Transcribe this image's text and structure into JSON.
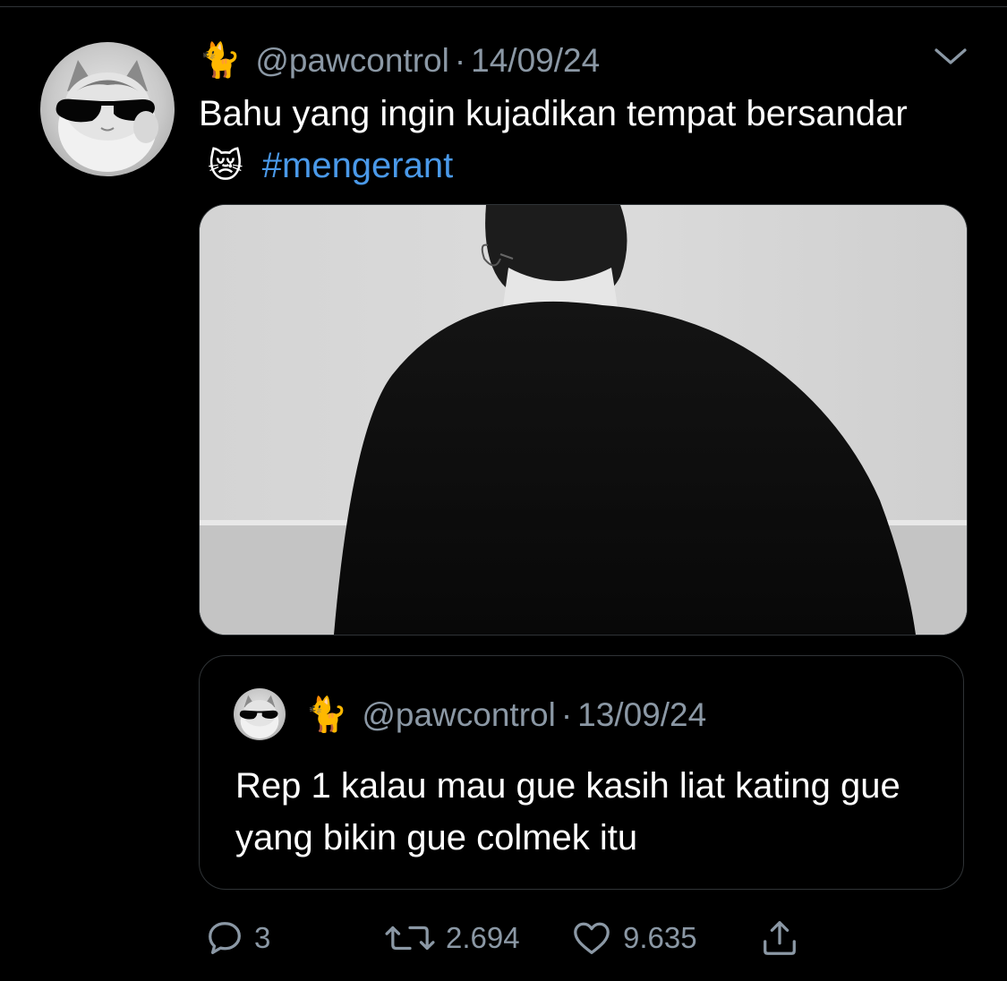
{
  "tweet": {
    "handle_emoji": "🐈",
    "handle": "@pawcontrol",
    "separator": "·",
    "date": "14/09/24",
    "text_main": "Bahu yang ingin kujadikan tempat bersandar",
    "text_emoji": "😿",
    "hashtag": "#mengerant",
    "media_alt_icon": "photo-icon"
  },
  "quote": {
    "handle_emoji": "🐈",
    "handle": "@pawcontrol",
    "separator": "·",
    "date": "13/09/24",
    "text": "Rep 1 kalau mau gue kasih liat kating gue yang bikin gue colmek itu"
  },
  "actions": {
    "replies": "3",
    "retweets": "2.694",
    "likes": "9.635"
  },
  "icons": {
    "reply": "reply-icon",
    "retweet": "retweet-icon",
    "like": "heart-icon",
    "share": "share-icon",
    "more": "chevron-down-icon"
  },
  "colors": {
    "background": "#000000",
    "secondary_text": "#8b98a5",
    "hashtag": "#4a99e9",
    "border": "#2f3336"
  }
}
